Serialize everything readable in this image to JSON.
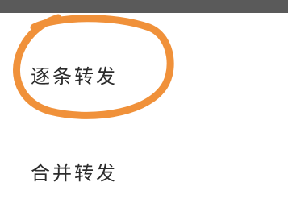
{
  "menu": {
    "items": [
      {
        "label": "逐条转发"
      },
      {
        "label": "合并转发"
      }
    ]
  },
  "annotation": {
    "shape": "hand-drawn-ellipse",
    "color": "#f0913a",
    "encircles": "逐条转发"
  }
}
